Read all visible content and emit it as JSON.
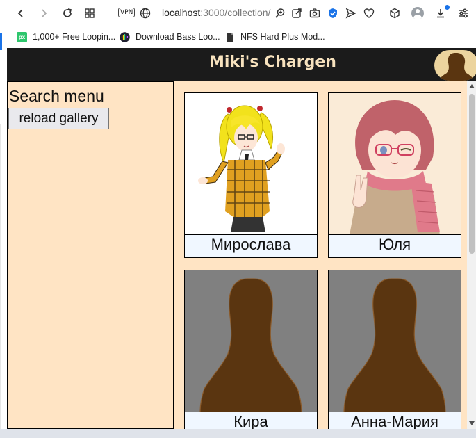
{
  "browser": {
    "url_host": "localhost",
    "url_path": ":3000/collection/",
    "vpn_label": "VPN",
    "bookmarks": [
      {
        "label": "1,000+ Free Loopin...",
        "icon": "pixabay-icon",
        "icon_text": "px"
      },
      {
        "label": "Download Bass Loo...",
        "icon": "soundwave-icon"
      },
      {
        "label": "NFS Hard Plus Mod...",
        "icon": "document-icon"
      }
    ]
  },
  "app": {
    "title": "Miki's Chargen"
  },
  "sidebar": {
    "title": "Search menu",
    "reload_label": "reload gallery"
  },
  "gallery": {
    "cards": [
      {
        "name": "Мирослава",
        "image": "anime-girl-blonde-pigtails"
      },
      {
        "name": "Юля",
        "image": "anime-girl-pink-scarf"
      },
      {
        "name": "Кира",
        "image": "silhouette-placeholder"
      },
      {
        "name": "Анна-Мария",
        "image": "silhouette-placeholder"
      }
    ]
  },
  "colors": {
    "header_bg": "#1b1b1b",
    "title_color": "#f7e2be",
    "panel_bg": "#ffe4c4",
    "caption_bg": "#f0f7ff",
    "silhouette_bg": "#808080",
    "silhouette_fg": "#5a3510"
  }
}
